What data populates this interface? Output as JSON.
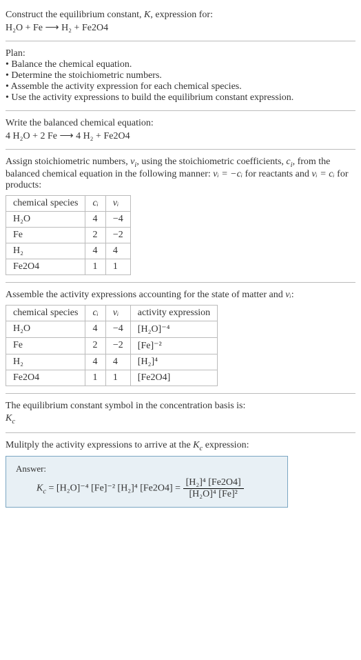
{
  "intro": {
    "line1_prefix": "Construct the equilibrium constant, ",
    "K": "K",
    "line1_suffix": ", expression for:",
    "equation": "H₂O + Fe ⟶ H₂ + Fe2O4"
  },
  "plan": {
    "heading": "Plan:",
    "items": [
      "Balance the chemical equation.",
      "Determine the stoichiometric numbers.",
      "Assemble the activity expression for each chemical species.",
      "Use the activity expressions to build the equilibrium constant expression."
    ]
  },
  "balanced": {
    "heading": "Write the balanced chemical equation:",
    "equation": "4 H₂O + 2 Fe ⟶ 4 H₂ + Fe2O4"
  },
  "stoich": {
    "text_part1": "Assign stoichiometric numbers, ",
    "nu_i": "ν",
    "nu_sub": "i",
    "text_part2": ", using the stoichiometric coefficients, ",
    "c_i": "c",
    "c_sub": "i",
    "text_part3": ", from the balanced chemical equation in the following manner: ",
    "rel1": "νᵢ = −cᵢ",
    "text_part4": " for reactants and ",
    "rel2": "νᵢ = cᵢ",
    "text_part5": " for products:",
    "headers": {
      "species": "chemical species",
      "ci": "cᵢ",
      "nui": "νᵢ"
    },
    "rows": [
      {
        "species": "H₂O",
        "ci": "4",
        "nui": "−4"
      },
      {
        "species": "Fe",
        "ci": "2",
        "nui": "−2"
      },
      {
        "species": "H₂",
        "ci": "4",
        "nui": "4"
      },
      {
        "species": "Fe2O4",
        "ci": "1",
        "nui": "1"
      }
    ]
  },
  "activity": {
    "heading_part1": "Assemble the activity expressions accounting for the state of matter and ",
    "heading_nu": "νᵢ",
    "heading_part2": ":",
    "headers": {
      "species": "chemical species",
      "ci": "cᵢ",
      "nui": "νᵢ",
      "act": "activity expression"
    },
    "rows": [
      {
        "species": "H₂O",
        "ci": "4",
        "nui": "−4",
        "act": "[H₂O]⁻⁴"
      },
      {
        "species": "Fe",
        "ci": "2",
        "nui": "−2",
        "act": "[Fe]⁻²"
      },
      {
        "species": "H₂",
        "ci": "4",
        "nui": "4",
        "act": "[H₂]⁴"
      },
      {
        "species": "Fe2O4",
        "ci": "1",
        "nui": "1",
        "act": "[Fe2O4]"
      }
    ]
  },
  "symbol": {
    "heading": "The equilibrium constant symbol in the concentration basis is:",
    "value": "K",
    "sub": "c"
  },
  "final": {
    "heading_part1": "Mulitply the activity expressions to arrive at the ",
    "kc": "K",
    "kc_sub": "c",
    "heading_part2": " expression:",
    "answer_label": "Answer:",
    "lhs_k": "K",
    "lhs_sub": "c",
    "eq_sign": " = ",
    "mid": "[H₂O]⁻⁴ [Fe]⁻² [H₂]⁴ [Fe2O4]",
    "eq_sign2": " = ",
    "frac_num": "[H₂]⁴ [Fe2O4]",
    "frac_den": "[H₂O]⁴ [Fe]²"
  }
}
